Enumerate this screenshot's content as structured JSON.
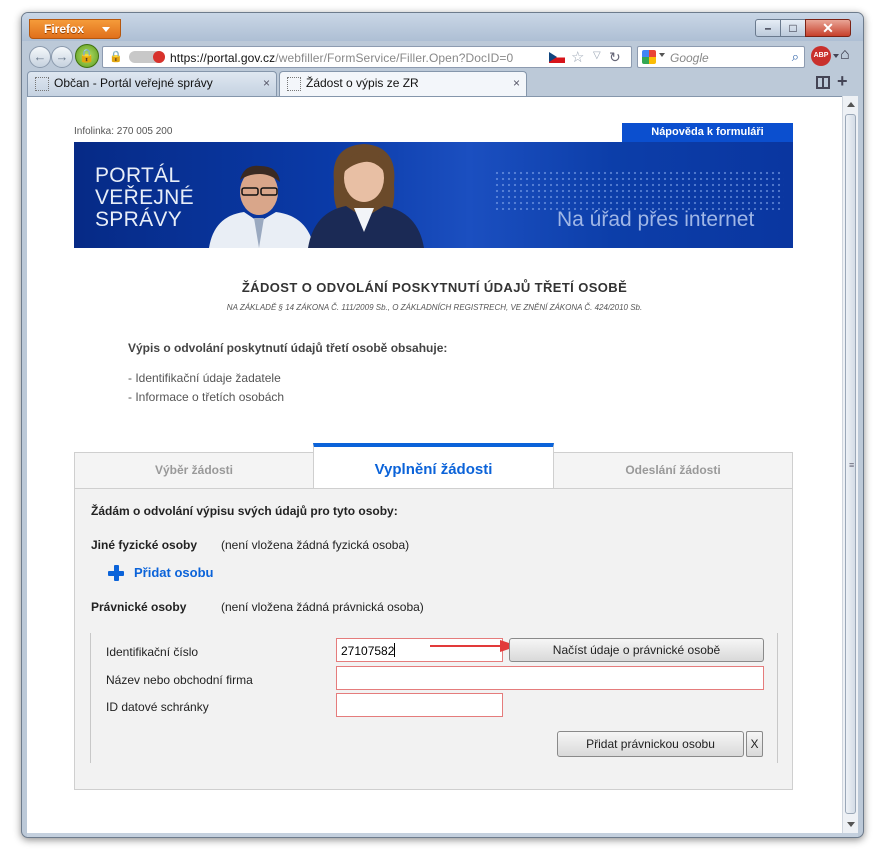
{
  "browser": {
    "app_button": "Firefox",
    "url_host": "https://portal.gov.cz",
    "url_path": "/webfiller/FormService/Filler.Open?DocID=0",
    "search_placeholder": "Google",
    "tabs": [
      {
        "label": "Občan - Portál veřejné správy"
      },
      {
        "label": "Žádost o výpis ze ZR"
      }
    ]
  },
  "header": {
    "infoline": "Infolinka: 270 005 200",
    "help_button": "Nápověda k formuláři",
    "logo_lines": [
      "PORTÁL",
      "VEŘEJNÉ",
      "SPRÁVY"
    ],
    "slogan": "Na úřad přes internet"
  },
  "form": {
    "title": "ŽÁDOST O ODVOLÁNÍ POSKYTNUTÍ ÚDAJŮ TŘETÍ OSOBĚ",
    "subtitle": "NA ZÁKLADĚ § 14 ZÁKONA Č. 111/2009 Sb., O ZÁKLADNÍCH REGISTRECH, VE ZNĚNÍ ZÁKONA Č. 424/2010 Sb.",
    "contents_title": "Výpis o odvolání poskytnutí údajů třetí osobě obsahuje:",
    "contents_items": [
      "- Identifikační údaje žadatele",
      "- Informace o třetích osobách"
    ]
  },
  "steps": [
    {
      "label": "Výběr žádosti"
    },
    {
      "label": "Vyplnění žádosti"
    },
    {
      "label": "Odeslání žádosti"
    }
  ],
  "panel": {
    "intro": "Žádám o odvolání výpisu svých údajů pro tyto osoby:",
    "natural_label": "Jiné fyzické osoby",
    "natural_note": "(není vložena žádná fyzická osoba)",
    "add_person": "Přidat osobu",
    "legal_label": "Právnické osoby",
    "legal_note": "(není vložena žádná právnická osoba)",
    "fields": {
      "ico_label": "Identifikační číslo",
      "ico_value": "27107582",
      "name_label": "Název nebo obchodní firma",
      "name_value": "",
      "databox_label": "ID datové schránky",
      "databox_value": ""
    },
    "load_button": "Načíst údaje o právnické osobě",
    "add_legal_button": "Přidat právnickou osobu",
    "close_button": "X"
  },
  "colors": {
    "accent": "#0b63d9",
    "banner": "#0a3aa7",
    "help_button": "#0b4fcf",
    "required_border": "#e57c7c",
    "arrow": "#e23a3a",
    "firefox_button": "#e8801f"
  }
}
